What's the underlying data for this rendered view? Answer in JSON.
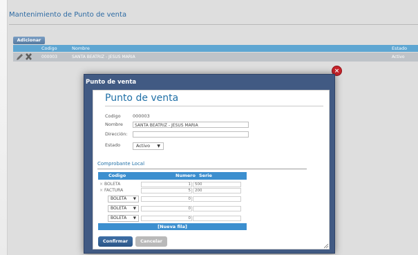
{
  "page": {
    "title": "Mantenimiento de Punto de venta",
    "add_button": "Adicionar",
    "grid": {
      "headers": {
        "codigo": "Codigo",
        "nombre": "Nombre",
        "estado": "Estado"
      },
      "rows": [
        {
          "codigo": "000003",
          "nombre": "SANTA BEATRIZ - JESUS MARIA",
          "estado": "Activo"
        }
      ]
    }
  },
  "dialog": {
    "window_title": "Punto de venta",
    "close_icon": "close-icon",
    "form_title": "Punto de venta",
    "codigo_label": "Codigo",
    "codigo_value": "000003",
    "nombre_label": "Nombre",
    "nombre_value": "SANTA BEATRIZ - JESUS MARIA",
    "direccion_label": "Dirección:",
    "direccion_value": "",
    "estado_label": "Estado",
    "estado_value": "Activo",
    "section_title": "Comprobante Local",
    "subgrid": {
      "headers": {
        "codigo": "Codigo",
        "numero": "Numero",
        "serie": "Serie"
      },
      "rows": [
        {
          "type": "text",
          "codigo": "BOLETA",
          "numero": "1",
          "serie": "500"
        },
        {
          "type": "text",
          "codigo": "FACTURA",
          "numero": "5",
          "serie": "200"
        },
        {
          "type": "select",
          "codigo": "BOLETA",
          "numero": "0",
          "serie": ""
        },
        {
          "type": "select",
          "codigo": "BOLETA",
          "numero": "0",
          "serie": ""
        },
        {
          "type": "select",
          "codigo": "BOLETA",
          "numero": "0",
          "serie": ""
        }
      ],
      "new_row": "[Nueva fila]"
    },
    "confirm_button": "Confirmar",
    "cancel_button": "Cancelar"
  },
  "colors": {
    "accent": "#1f6fa6",
    "header": "#5ea6d2",
    "dialog_frame": "#415a83",
    "close": "#c8242b"
  }
}
